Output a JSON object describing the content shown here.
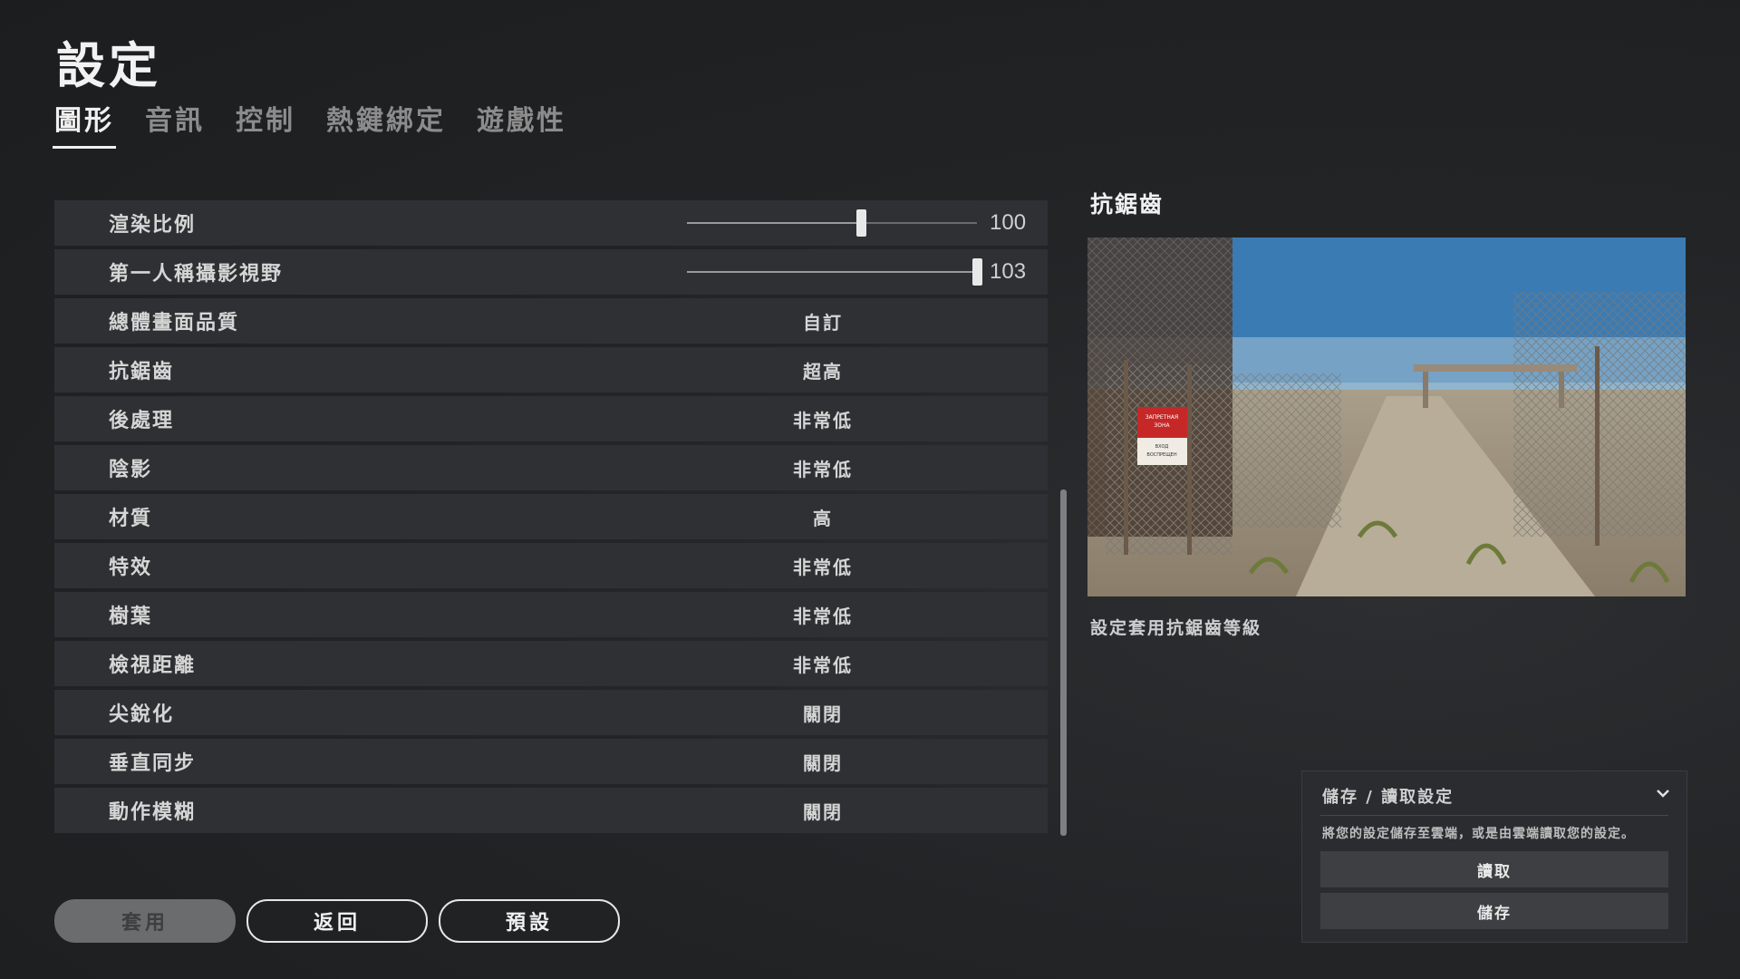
{
  "page": {
    "title": "設定"
  },
  "tabs": [
    {
      "label": "圖形",
      "active": true
    },
    {
      "label": "音訊",
      "active": false
    },
    {
      "label": "控制",
      "active": false
    },
    {
      "label": "熱鍵綁定",
      "active": false
    },
    {
      "label": "遊戲性",
      "active": false
    }
  ],
  "settings": {
    "render_scale": {
      "label": "渲染比例",
      "value": "100",
      "slider_fraction": 0.6
    },
    "fpp_fov": {
      "label": "第一人稱攝影視野",
      "value": "103",
      "slider_fraction": 1.0
    },
    "rows": [
      {
        "label": "總體畫面品質",
        "value": "自訂"
      },
      {
        "label": "抗鋸齒",
        "value": "超高"
      },
      {
        "label": "後處理",
        "value": "非常低"
      },
      {
        "label": "陰影",
        "value": "非常低"
      },
      {
        "label": "材質",
        "value": "高"
      },
      {
        "label": "特效",
        "value": "非常低"
      },
      {
        "label": "樹葉",
        "value": "非常低"
      },
      {
        "label": "檢視距離",
        "value": "非常低"
      },
      {
        "label": "尖銳化",
        "value": "關閉"
      },
      {
        "label": "垂直同步",
        "value": "關閉"
      },
      {
        "label": "動作模糊",
        "value": "關閉"
      }
    ]
  },
  "preview": {
    "title": "抗鋸齒",
    "description": "設定套用抗鋸齒等級",
    "sign_text": [
      "ЗАПРЕТНАЯ",
      "ЗОНА",
      "ВХОД",
      "ВОСПРЕЩЕН"
    ]
  },
  "buttons": {
    "apply": "套用",
    "back": "返回",
    "default": "預設"
  },
  "save_panel": {
    "header": "儲存 / 讀取設定",
    "description": "將您的設定儲存至雲端，或是由雲端讀取您的設定。",
    "load": "讀取",
    "save": "儲存"
  }
}
